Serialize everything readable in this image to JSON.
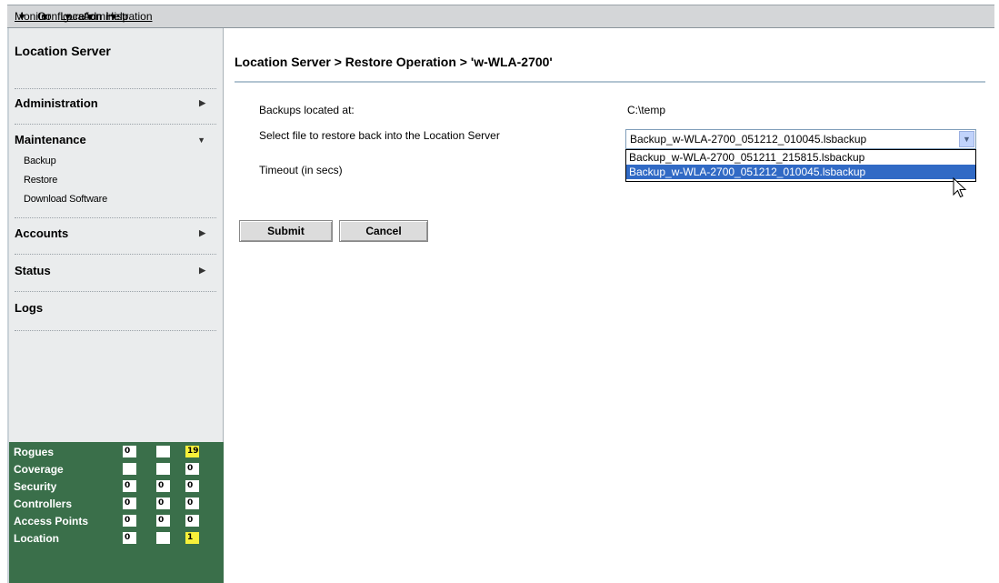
{
  "menubar": {
    "items": [
      {
        "label": "Monitor"
      },
      {
        "label": "Configure"
      },
      {
        "label": "Location"
      },
      {
        "label": "Administration"
      },
      {
        "label": "Help"
      }
    ]
  },
  "sidebar": {
    "title": "Location Server",
    "sections": [
      {
        "label": "Administration"
      },
      {
        "label": "Maintenance",
        "items": [
          "Backup",
          "Restore",
          "Download Software"
        ]
      },
      {
        "label": "Accounts"
      },
      {
        "label": "Status"
      },
      {
        "label": "Logs"
      }
    ]
  },
  "summary": {
    "rows": [
      {
        "label": "Rogues",
        "cells": [
          "0",
          "",
          "19"
        ],
        "highlight": [
          false,
          false,
          true
        ]
      },
      {
        "label": "Coverage",
        "cells": [
          "",
          "",
          "0"
        ],
        "highlight": [
          false,
          false,
          false
        ]
      },
      {
        "label": "Security",
        "cells": [
          "0",
          "0",
          "0"
        ],
        "highlight": [
          false,
          false,
          false
        ]
      },
      {
        "label": "Controllers",
        "cells": [
          "0",
          "0",
          "0"
        ],
        "highlight": [
          false,
          false,
          false
        ]
      },
      {
        "label": "Access Points",
        "cells": [
          "0",
          "0",
          "0"
        ],
        "highlight": [
          false,
          false,
          false
        ]
      },
      {
        "label": "Location",
        "cells": [
          "0",
          "",
          "1"
        ],
        "highlight": [
          false,
          false,
          true
        ]
      }
    ],
    "colors": {
      "background": "#3a6f4a",
      "alert": "#f7f03a"
    }
  },
  "main": {
    "breadcrumb": "Location Server > Restore Operation > 'w-WLA-2700'",
    "backups_label": "Backups located at:",
    "backups_value": "C:\\temp",
    "select_label": "Select file to restore back into the Location Server",
    "select_value": "Backup_w-WLA-2700_051212_010045.lsbackup",
    "select_options": [
      "Backup_w-WLA-2700_051211_215815.lsbackup",
      "Backup_w-WLA-2700_051212_010045.lsbackup"
    ],
    "timeout_label": "Timeout (in secs)",
    "submit_label": "Submit",
    "cancel_label": "Cancel"
  }
}
